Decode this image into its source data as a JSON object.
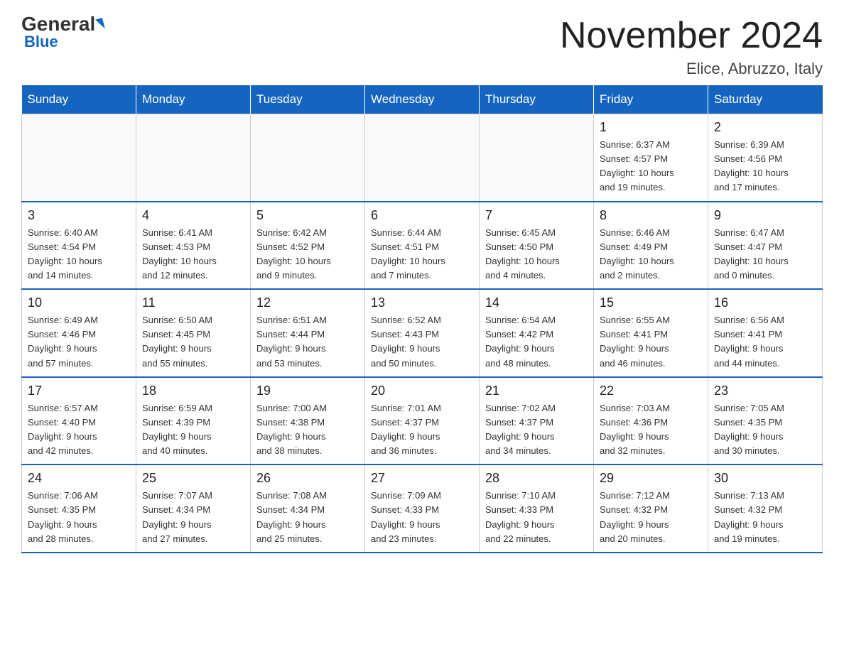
{
  "header": {
    "logo_general": "General",
    "logo_blue": "Blue",
    "title": "November 2024",
    "subtitle": "Elice, Abruzzo, Italy"
  },
  "weekdays": [
    "Sunday",
    "Monday",
    "Tuesday",
    "Wednesday",
    "Thursday",
    "Friday",
    "Saturday"
  ],
  "weeks": [
    [
      {
        "date": "",
        "info": ""
      },
      {
        "date": "",
        "info": ""
      },
      {
        "date": "",
        "info": ""
      },
      {
        "date": "",
        "info": ""
      },
      {
        "date": "",
        "info": ""
      },
      {
        "date": "1",
        "info": "Sunrise: 6:37 AM\nSunset: 4:57 PM\nDaylight: 10 hours\nand 19 minutes."
      },
      {
        "date": "2",
        "info": "Sunrise: 6:39 AM\nSunset: 4:56 PM\nDaylight: 10 hours\nand 17 minutes."
      }
    ],
    [
      {
        "date": "3",
        "info": "Sunrise: 6:40 AM\nSunset: 4:54 PM\nDaylight: 10 hours\nand 14 minutes."
      },
      {
        "date": "4",
        "info": "Sunrise: 6:41 AM\nSunset: 4:53 PM\nDaylight: 10 hours\nand 12 minutes."
      },
      {
        "date": "5",
        "info": "Sunrise: 6:42 AM\nSunset: 4:52 PM\nDaylight: 10 hours\nand 9 minutes."
      },
      {
        "date": "6",
        "info": "Sunrise: 6:44 AM\nSunset: 4:51 PM\nDaylight: 10 hours\nand 7 minutes."
      },
      {
        "date": "7",
        "info": "Sunrise: 6:45 AM\nSunset: 4:50 PM\nDaylight: 10 hours\nand 4 minutes."
      },
      {
        "date": "8",
        "info": "Sunrise: 6:46 AM\nSunset: 4:49 PM\nDaylight: 10 hours\nand 2 minutes."
      },
      {
        "date": "9",
        "info": "Sunrise: 6:47 AM\nSunset: 4:47 PM\nDaylight: 10 hours\nand 0 minutes."
      }
    ],
    [
      {
        "date": "10",
        "info": "Sunrise: 6:49 AM\nSunset: 4:46 PM\nDaylight: 9 hours\nand 57 minutes."
      },
      {
        "date": "11",
        "info": "Sunrise: 6:50 AM\nSunset: 4:45 PM\nDaylight: 9 hours\nand 55 minutes."
      },
      {
        "date": "12",
        "info": "Sunrise: 6:51 AM\nSunset: 4:44 PM\nDaylight: 9 hours\nand 53 minutes."
      },
      {
        "date": "13",
        "info": "Sunrise: 6:52 AM\nSunset: 4:43 PM\nDaylight: 9 hours\nand 50 minutes."
      },
      {
        "date": "14",
        "info": "Sunrise: 6:54 AM\nSunset: 4:42 PM\nDaylight: 9 hours\nand 48 minutes."
      },
      {
        "date": "15",
        "info": "Sunrise: 6:55 AM\nSunset: 4:41 PM\nDaylight: 9 hours\nand 46 minutes."
      },
      {
        "date": "16",
        "info": "Sunrise: 6:56 AM\nSunset: 4:41 PM\nDaylight: 9 hours\nand 44 minutes."
      }
    ],
    [
      {
        "date": "17",
        "info": "Sunrise: 6:57 AM\nSunset: 4:40 PM\nDaylight: 9 hours\nand 42 minutes."
      },
      {
        "date": "18",
        "info": "Sunrise: 6:59 AM\nSunset: 4:39 PM\nDaylight: 9 hours\nand 40 minutes."
      },
      {
        "date": "19",
        "info": "Sunrise: 7:00 AM\nSunset: 4:38 PM\nDaylight: 9 hours\nand 38 minutes."
      },
      {
        "date": "20",
        "info": "Sunrise: 7:01 AM\nSunset: 4:37 PM\nDaylight: 9 hours\nand 36 minutes."
      },
      {
        "date": "21",
        "info": "Sunrise: 7:02 AM\nSunset: 4:37 PM\nDaylight: 9 hours\nand 34 minutes."
      },
      {
        "date": "22",
        "info": "Sunrise: 7:03 AM\nSunset: 4:36 PM\nDaylight: 9 hours\nand 32 minutes."
      },
      {
        "date": "23",
        "info": "Sunrise: 7:05 AM\nSunset: 4:35 PM\nDaylight: 9 hours\nand 30 minutes."
      }
    ],
    [
      {
        "date": "24",
        "info": "Sunrise: 7:06 AM\nSunset: 4:35 PM\nDaylight: 9 hours\nand 28 minutes."
      },
      {
        "date": "25",
        "info": "Sunrise: 7:07 AM\nSunset: 4:34 PM\nDaylight: 9 hours\nand 27 minutes."
      },
      {
        "date": "26",
        "info": "Sunrise: 7:08 AM\nSunset: 4:34 PM\nDaylight: 9 hours\nand 25 minutes."
      },
      {
        "date": "27",
        "info": "Sunrise: 7:09 AM\nSunset: 4:33 PM\nDaylight: 9 hours\nand 23 minutes."
      },
      {
        "date": "28",
        "info": "Sunrise: 7:10 AM\nSunset: 4:33 PM\nDaylight: 9 hours\nand 22 minutes."
      },
      {
        "date": "29",
        "info": "Sunrise: 7:12 AM\nSunset: 4:32 PM\nDaylight: 9 hours\nand 20 minutes."
      },
      {
        "date": "30",
        "info": "Sunrise: 7:13 AM\nSunset: 4:32 PM\nDaylight: 9 hours\nand 19 minutes."
      }
    ]
  ]
}
